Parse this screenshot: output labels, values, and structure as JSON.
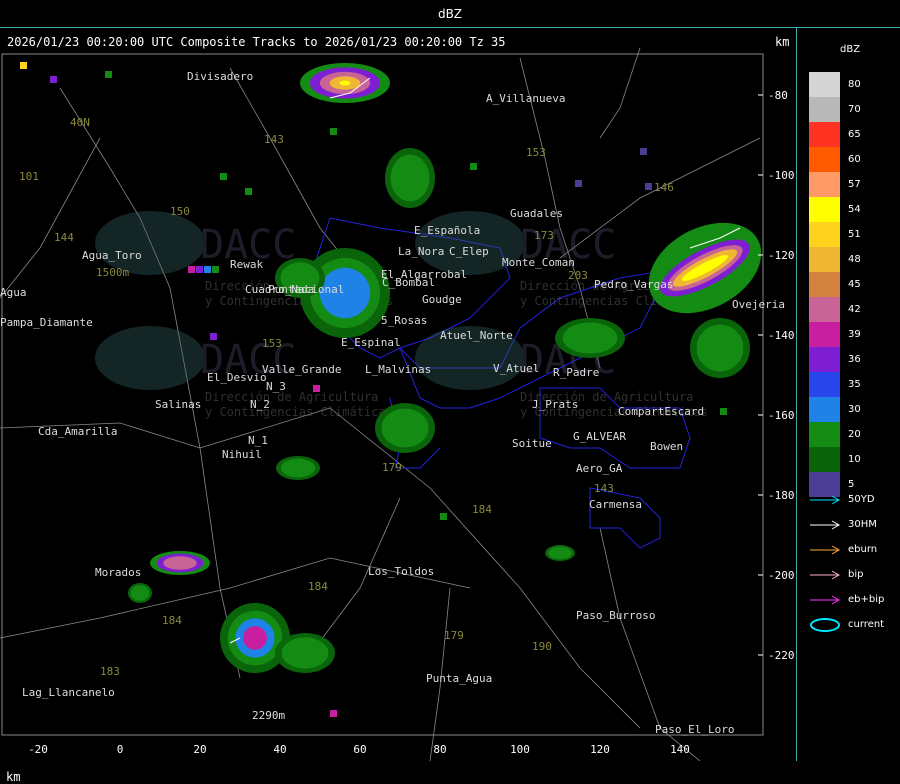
{
  "header": {
    "title": "dBZ"
  },
  "map": {
    "title": "2026/01/23 00:20:00 UTC Composite Tracks to 2026/01/23 00:20:00 Tz 35",
    "unit_top": "km",
    "unit_bottom": "km",
    "x_ticks": [
      "-20",
      "0",
      "20",
      "40",
      "60",
      "80",
      "100",
      "120",
      "140"
    ],
    "y_ticks": [
      "-80",
      "-100",
      "-120",
      "-140",
      "-160",
      "-180",
      "-200",
      "-220"
    ],
    "places": [
      {
        "name": "Divisadero"
      },
      {
        "name": "A_Villanueva"
      },
      {
        "name": "Guadales"
      },
      {
        "name": "Agua_Toro"
      },
      {
        "name": "Rewak"
      },
      {
        "name": "La_Nora"
      },
      {
        "name": "E_Española"
      },
      {
        "name": "C_Elep"
      },
      {
        "name": "Pampa_Diamante"
      },
      {
        "name": "Agua"
      },
      {
        "name": "El_Algarrobal"
      },
      {
        "name": "C_Bombal"
      },
      {
        "name": "Monte_Coman"
      },
      {
        "name": "Pedro_Vargas"
      },
      {
        "name": "Cuadro_Nacional"
      },
      {
        "name": "Goudge"
      },
      {
        "name": "5_Rosas"
      },
      {
        "name": "Atuel_Norte"
      },
      {
        "name": "E_Espinal"
      },
      {
        "name": "El_Desvio"
      },
      {
        "name": "Valle_Grande"
      },
      {
        "name": "L_Malvinas"
      },
      {
        "name": "V_Atuel"
      },
      {
        "name": "R_Padre"
      },
      {
        "name": "Salinas"
      },
      {
        "name": "Cda_Amarilla"
      },
      {
        "name": "J_Prats"
      },
      {
        "name": "CompartEscard"
      },
      {
        "name": "G_ALVEAR"
      },
      {
        "name": "Nihuil"
      },
      {
        "name": "Soitue"
      },
      {
        "name": "Bowen"
      },
      {
        "name": "Aero_GA"
      },
      {
        "name": "Carmensa"
      },
      {
        "name": "Morados"
      },
      {
        "name": "Los_Toldos"
      },
      {
        "name": "Paso_Burroso"
      },
      {
        "name": "Lag_Llancanelo"
      },
      {
        "name": "Punta_Agua"
      },
      {
        "name": "Paso_El_Loro"
      },
      {
        "name": "Ovejeria"
      },
      {
        "name": "N_3"
      },
      {
        "name": "N_2"
      },
      {
        "name": "N_1"
      },
      {
        "name": "Puntada"
      },
      {
        "name": "2290m"
      }
    ],
    "routes": [
      "143",
      "153",
      "146",
      "40N",
      "101",
      "150",
      "144",
      "173",
      "203",
      "153",
      "184",
      "184",
      "179",
      "184",
      "179",
      "190",
      "183",
      "143",
      "1500m"
    ],
    "watermark": {
      "text": "DACC",
      "sub1": "Dirección de Agricultura",
      "sub2": "y Contingencias Climáticas"
    }
  },
  "legend": {
    "title": "dBZ",
    "levels": [
      {
        "label": "80",
        "color": "#d4d4d4"
      },
      {
        "label": "70",
        "color": "#b8b8b8"
      },
      {
        "label": "65",
        "color": "#ff3322"
      },
      {
        "label": "60",
        "color": "#ff5a00"
      },
      {
        "label": "57",
        "color": "#ff9966"
      },
      {
        "label": "54",
        "color": "#ffff00"
      },
      {
        "label": "51",
        "color": "#ffd21e"
      },
      {
        "label": "48",
        "color": "#f0b832"
      },
      {
        "label": "45",
        "color": "#d2823c"
      },
      {
        "label": "42",
        "color": "#c86496"
      },
      {
        "label": "39",
        "color": "#c81ea0"
      },
      {
        "label": "36",
        "color": "#7d1ed2"
      },
      {
        "label": "35",
        "color": "#2846eb"
      },
      {
        "label": "30",
        "color": "#1e82e6"
      },
      {
        "label": "20",
        "color": "#148c14"
      },
      {
        "label": "10",
        "color": "#0a640a"
      },
      {
        "label": "5",
        "color": "#4b3c96"
      }
    ],
    "tracks": [
      {
        "label": "50YD",
        "color": "#00e5ff"
      },
      {
        "label": "30HM",
        "color": "#ffffff"
      },
      {
        "label": "eburn",
        "color": "#ffaa33"
      },
      {
        "label": "bip",
        "color": "#ffb0c8"
      },
      {
        "label": "eb+bip",
        "color": "#ff33ff"
      },
      {
        "label": "current",
        "color": "#00e5ff"
      }
    ]
  }
}
